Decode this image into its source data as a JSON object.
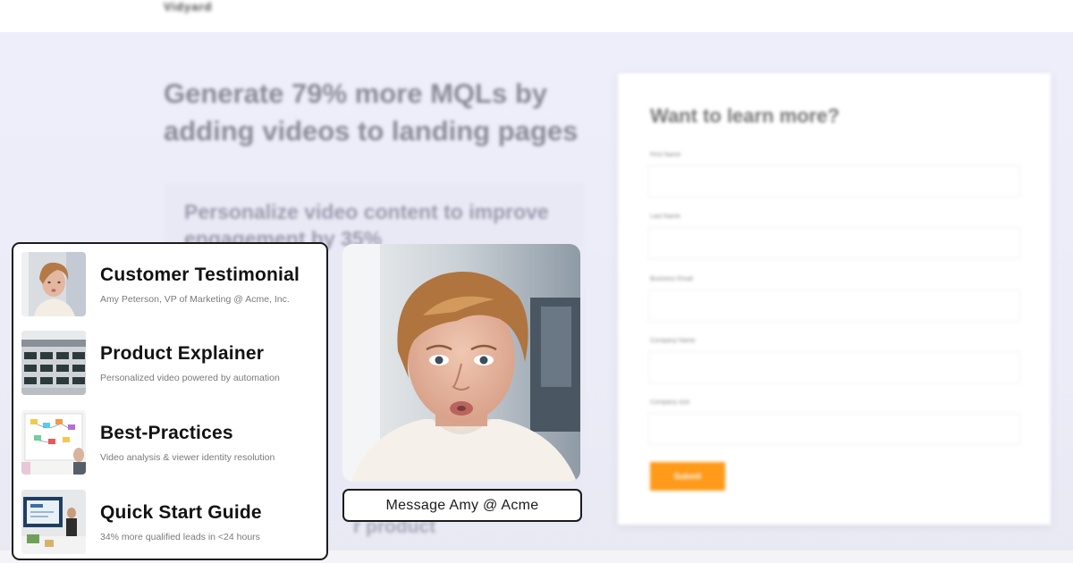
{
  "page": {
    "logo": "Vidyard",
    "headline": "Generate 79% more MQLs by adding videos to landing pages",
    "subheading": "Personalize video content to improve engagement by 35%",
    "subheading_bottom": "r product"
  },
  "form": {
    "title": "Want to learn more?",
    "fields": [
      {
        "label": "First Name",
        "value": ""
      },
      {
        "label": "Last Name",
        "value": ""
      },
      {
        "label": "Business Email",
        "value": ""
      },
      {
        "label": "Company Name",
        "value": ""
      },
      {
        "label": "Company size",
        "value": ""
      }
    ],
    "submit_label": "Submit",
    "accent": "#ff9a1a"
  },
  "menu": {
    "items": [
      {
        "title": "Customer Testimonial",
        "subtitle": "Amy Peterson, VP of Marketing @ Acme, Inc."
      },
      {
        "title": "Product Explainer",
        "subtitle": "Personalized video powered by automation"
      },
      {
        "title": "Best-Practices",
        "subtitle": "Video analysis & viewer identity resolution"
      },
      {
        "title": "Quick Start Guide",
        "subtitle": "34% more qualified leads in <24 hours"
      }
    ]
  },
  "video": {
    "message_button": "Message Amy @ Acme"
  },
  "colors": {
    "background": "#ececf8",
    "panel_border": "#1b1b1b",
    "submit": "#ff9a1a"
  }
}
